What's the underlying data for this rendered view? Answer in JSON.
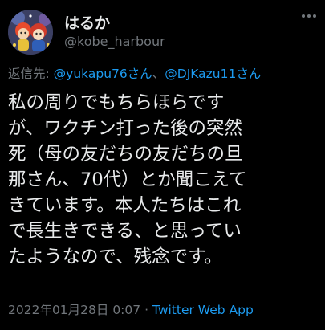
{
  "tweet": {
    "display_name": "はるか",
    "handle": "@kobe_harbour",
    "reply": {
      "prefix": "返信先: ",
      "mention1": "@yukapu76さん",
      "separator": "、",
      "mention2": "@DJKazu11さん"
    },
    "body": "私の周りでもちらほらです\nが、ワクチン打った後の突然\n死（母の友だちの友だちの旦\n那さん、70代）とか聞こえて\nきています。本人たちはこれ\nで長生きできる、と思ってい\nたようなので、残念です。",
    "timestamp": "2022年01月28日 0:07",
    "dot": " · ",
    "app": "Twitter Web App"
  },
  "colors": {
    "background": "#000000",
    "text": "#e7e9ea",
    "secondary": "#71767b",
    "link": "#1d9bf0"
  },
  "icons": {
    "more": "more-icon",
    "avatar": "avatar"
  }
}
